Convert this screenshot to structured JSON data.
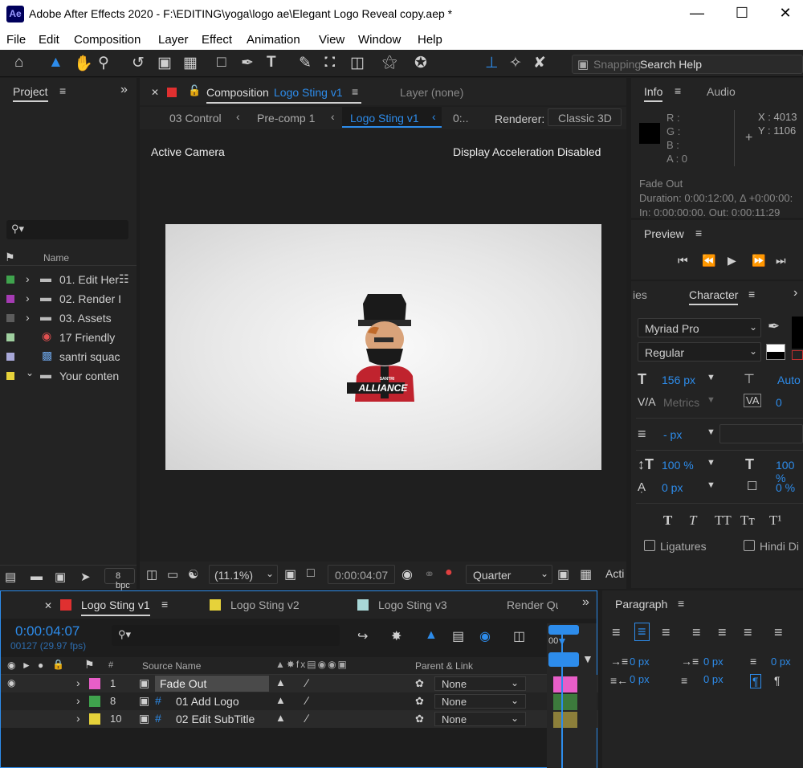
{
  "window": {
    "icon_label": "Ae",
    "title": "Adobe After Effects 2020 - F:\\EDITING\\yoga\\logo ae\\Elegant Logo Reveal copy.aep *"
  },
  "menu": [
    "File",
    "Edit",
    "Composition",
    "Layer",
    "Effect",
    "Animation",
    "View",
    "Window",
    "Help"
  ],
  "toolbar": {
    "snapping_label": "Snapping",
    "search_help": "Search Help"
  },
  "project": {
    "title": "Project",
    "column_name": "Name",
    "items": [
      {
        "color": "#3fa34d",
        "name": "01. Edit Her"
      },
      {
        "color": "#a53bb3",
        "name": "02. Render I"
      },
      {
        "color": "#5c5c5c",
        "name": "03. Assets"
      },
      {
        "color": "#9fcf9f",
        "name": "17 Friendly"
      },
      {
        "color": "#a8a8d8",
        "name": "santri squac"
      },
      {
        "color": "#e6d23a",
        "name": "Your conten"
      }
    ],
    "bpc": "8 bpc"
  },
  "comp": {
    "tab_prefix": "Composition",
    "tab_name": "Logo Sting v1",
    "layer_tab": "Layer (none)",
    "crumbs": [
      "03 Control",
      "Pre-comp 1",
      "Logo Sting v1",
      "0:.."
    ],
    "renderer_label": "Renderer:",
    "renderer_value": "Classic 3D",
    "active_camera": "Active Camera",
    "accel": "Display Acceleration Disabled",
    "logo_small": "SANTRI",
    "logo_text": "ALLIANCE",
    "zoom": "(11.1%)",
    "timecode": "0:00:04:07",
    "resolution": "Quarter",
    "view": "Acti"
  },
  "info": {
    "tab_info": "Info",
    "tab_audio": "Audio",
    "r": "R :",
    "g": "G :",
    "b": "B :",
    "a": "A : 0",
    "x": "X : 4013",
    "y": "Y : 1106",
    "layer_name": "Fade Out",
    "duration": "Duration: 0:00:12:00, Δ +0:00:00:",
    "inout": "In: 0:00:00:00, Out: 0:00:11:29"
  },
  "preview": {
    "title": "Preview"
  },
  "character": {
    "tab_prev": "ies",
    "title": "Character",
    "font": "Myriad Pro",
    "style": "Regular",
    "size": "156 px",
    "leading": "Auto",
    "kerning": "Metrics",
    "tracking": "0",
    "stroke": "- px",
    "vscale": "100 %",
    "hscale": "100 %",
    "baseline": "0 px",
    "tsume": "0 %",
    "ligatures": "Ligatures",
    "hindi": "Hindi Di"
  },
  "timeline": {
    "tabs": [
      {
        "color": "#e03030",
        "name": "Logo Sting v1"
      },
      {
        "color": "#e6d23a",
        "name": "Logo Sting v2"
      },
      {
        "color": "#a8d8d8",
        "name": "Logo Sting v3"
      },
      {
        "color": "",
        "name": "Render Qu"
      }
    ],
    "timecode": "0:00:04:07",
    "frames": "00127 (29.97 fps)",
    "col_num": "#",
    "col_source": "Source Name",
    "col_parent": "Parent & Link",
    "ruler": "00",
    "layers": [
      {
        "color": "#e85ec8",
        "num": "1",
        "name": "Fade Out",
        "parent": "None",
        "bar": "#e85ec8"
      },
      {
        "color": "#3fa34d",
        "num": "8",
        "name": "01 Add Logo",
        "parent": "None",
        "bar": "#3c7a3c"
      },
      {
        "color": "#e6d23a",
        "num": "10",
        "name": "02 Edit SubTitle",
        "parent": "None",
        "bar": "#8c7f3a"
      }
    ]
  },
  "paragraph": {
    "title": "Paragraph",
    "indent_left": "0 px",
    "indent_first": "0 px",
    "indent_right": "0 px",
    "space_before": "0 px",
    "space_after": "0 px"
  }
}
